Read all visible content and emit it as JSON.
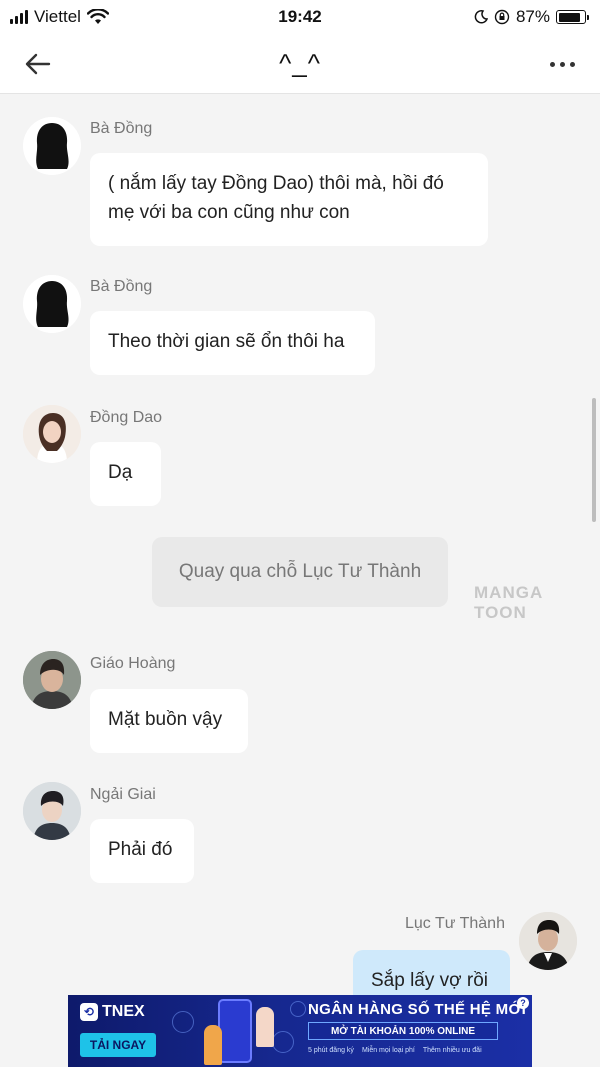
{
  "status_bar": {
    "carrier": "Viettel",
    "time": "19:42",
    "battery_percent": "87%",
    "battery_level": 0.87
  },
  "header": {
    "title": "^_^",
    "back_icon": "arrow-left-icon",
    "more_icon": "more-dots-icon"
  },
  "messages": [
    {
      "sender": "Bà Đồng",
      "lines": [
        "( nắm lấy tay Đồng Dao) thôi mà, hồi đó",
        "mẹ với ba con cũng như con"
      ]
    },
    {
      "sender": "Bà Đồng",
      "lines": [
        "Theo thời gian sẽ ổn thôi ha"
      ]
    },
    {
      "sender": "Đồng Dao",
      "lines": [
        "Dạ"
      ]
    },
    {
      "narration": "Quay qua chỗ Lục Tư Thành"
    },
    {
      "sender": "Giáo Hoàng",
      "lines": [
        "Mặt buồn vậy"
      ]
    },
    {
      "sender": "Ngải Giai",
      "lines": [
        "Phải đó"
      ]
    },
    {
      "sender": "Lục Tư Thành",
      "lines": [
        "Sắp lấy vợ rồi"
      ],
      "mine": true
    }
  ],
  "watermark": "MANGA TOON",
  "ad": {
    "brand": "TNEX",
    "cta": "TẢI NGAY",
    "headline": "NGÂN HÀNG SỐ THẾ HỆ MỚI",
    "subline": "MỞ TÀI KHOẢN 100% ONLINE",
    "features": [
      "5 phút đăng ký",
      "Miễn mọi loại phí",
      "Thêm nhiều ưu đãi"
    ],
    "info": "?"
  },
  "colors": {
    "background": "#f4f4f4",
    "bubble": "#ffffff",
    "bubble_mine": "#cfe9fb",
    "narration": "#e9e9e9"
  }
}
